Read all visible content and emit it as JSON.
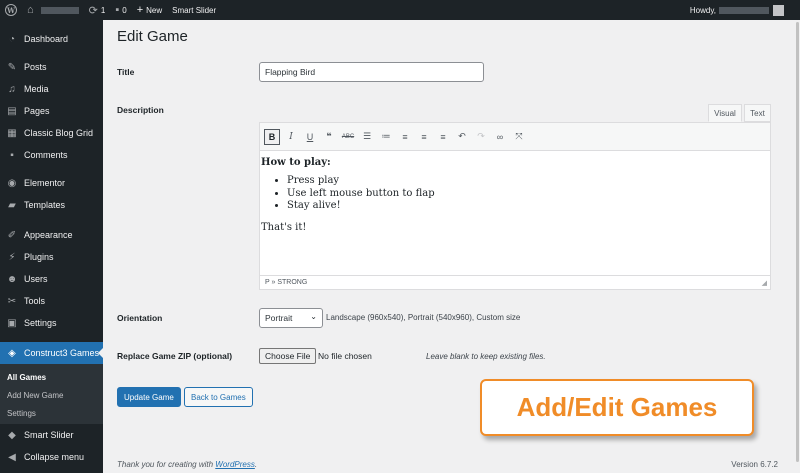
{
  "adminbar": {
    "comments_count": "0",
    "updates_count": "1",
    "new_label": "New",
    "plugin_label": "Smart Slider",
    "howdy": "Howdy,"
  },
  "sidebar": {
    "items": [
      {
        "label": "Dashboard",
        "icon": "dashboard-icon"
      },
      {
        "label": "Posts",
        "icon": "pin-icon"
      },
      {
        "label": "Media",
        "icon": "media-icon"
      },
      {
        "label": "Pages",
        "icon": "pages-icon"
      },
      {
        "label": "Classic Blog Grid",
        "icon": "grid-icon"
      },
      {
        "label": "Comments",
        "icon": "comment-icon"
      },
      {
        "label": "Elementor",
        "icon": "elementor-icon"
      },
      {
        "label": "Templates",
        "icon": "folder-icon"
      },
      {
        "label": "Appearance",
        "icon": "brush-icon"
      },
      {
        "label": "Plugins",
        "icon": "plugin-icon"
      },
      {
        "label": "Users",
        "icon": "user-icon"
      },
      {
        "label": "Tools",
        "icon": "wrench-icon"
      },
      {
        "label": "Settings",
        "icon": "settings-icon"
      },
      {
        "label": "Construct3 Games",
        "icon": "gamepad-icon"
      },
      {
        "label": "Smart Slider",
        "icon": "slider-icon"
      },
      {
        "label": "Collapse menu",
        "icon": "collapse-icon"
      }
    ],
    "submenu": [
      "All Games",
      "Add New Game",
      "Settings"
    ]
  },
  "main": {
    "page_title": "Edit Game",
    "title_label": "Title",
    "title_value": "Flapping Bird",
    "description_label": "Description",
    "tab_visual": "Visual",
    "tab_text": "Text",
    "editor": {
      "heading": "How to play:",
      "list": [
        "Press play",
        "Use left mouse button to flap",
        "Stay alive!"
      ],
      "closing": "That's it!",
      "statusbar": "P » STRONG"
    },
    "orientation_label": "Orientation",
    "orientation_value": "Portrait",
    "orientation_hint": "Landscape (960x540), Portrait (540x960), Custom size",
    "zip_label": "Replace Game ZIP (optional)",
    "choose_file": "Choose File",
    "no_file": "No file chosen",
    "zip_hint": "Leave blank to keep existing files.",
    "update_button": "Update Game",
    "back_button": "Back to Games",
    "callout": "Add/Edit Games"
  },
  "footer": {
    "thanks_prefix": "Thank you for creating with ",
    "thanks_link": "WordPress",
    "thanks_suffix": ".",
    "version": "Version 6.7.2"
  },
  "colors": {
    "adminbar_bg": "#1d2327",
    "accent": "#2271b1",
    "callout": "#f08c28"
  }
}
